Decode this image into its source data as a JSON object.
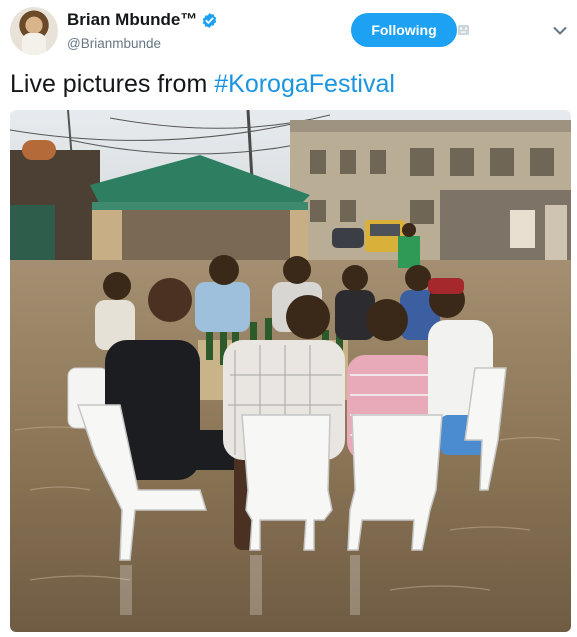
{
  "author": {
    "display_name": "Brian Mbunde™",
    "handle": "@Brianmbunde",
    "verified": true
  },
  "follow_button": {
    "label": "Following",
    "color": "#1da1f2"
  },
  "icons": {
    "verified": "verified-badge-icon",
    "mute": "muted-icon",
    "menu": "chevron-down-icon"
  },
  "tweet": {
    "text_prefix": "Live pictures from ",
    "hashtag": "#KorogaFestival",
    "hashtag_color": "#1b95e0"
  },
  "media": {
    "type": "photo",
    "subject": "people-seated-around-table-in-flooded-street"
  }
}
